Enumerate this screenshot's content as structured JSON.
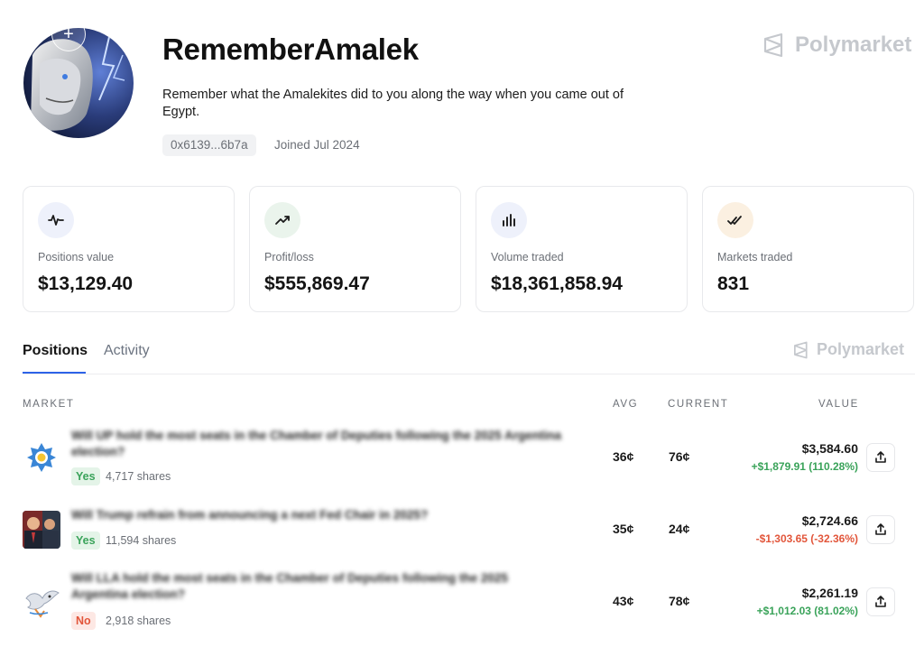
{
  "profile": {
    "username": "RememberAmalek",
    "bio": "Remember what the Amalekites did to you along the way when you came out of Egypt.",
    "address": "0x6139...6b7a",
    "joined": "Joined Jul 2024"
  },
  "brand": {
    "name": "Polymarket"
  },
  "stats": [
    {
      "label": "Positions value",
      "value": "$13,129.40",
      "icon": "activity-icon",
      "color": "#eef1fb"
    },
    {
      "label": "Profit/loss",
      "value": "$555,869.47",
      "icon": "trending-up-icon",
      "color": "#eaf4ec"
    },
    {
      "label": "Volume traded",
      "value": "$18,361,858.94",
      "icon": "bar-chart-icon",
      "color": "#eef1fb"
    },
    {
      "label": "Markets traded",
      "value": "831",
      "icon": "double-check-icon",
      "color": "#fbf0e1"
    }
  ],
  "tabs": {
    "positions": "Positions",
    "activity": "Activity"
  },
  "table": {
    "headers": {
      "market": "MARKET",
      "avg": "AVG",
      "current": "CURRENT",
      "value": "VALUE"
    },
    "rows": [
      {
        "title": "Will UP hold the most seats in the Chamber of Deputies following the 2025 Argentina election?",
        "outcome": "Yes",
        "shares": "4,717 shares",
        "avg": "36¢",
        "current": "76¢",
        "value": "$3,584.60",
        "pnl": "+$1,879.91 (110.28%)",
        "pnl_direction": "up"
      },
      {
        "title": "Will Trump refrain from announcing a next Fed Chair in 2025?",
        "outcome": "Yes",
        "shares": "11,594 shares",
        "avg": "35¢",
        "current": "24¢",
        "value": "$2,724.66",
        "pnl": "-$1,303.65 (-32.36%)",
        "pnl_direction": "down"
      },
      {
        "title": "Will LLA hold the most seats in the Chamber of Deputies following the 2025 Argentina election?",
        "outcome": "No",
        "shares": "2,918 shares",
        "avg": "43¢",
        "current": "78¢",
        "value": "$2,261.19",
        "pnl": "+$1,012.03 (81.02%)",
        "pnl_direction": "up"
      }
    ]
  }
}
